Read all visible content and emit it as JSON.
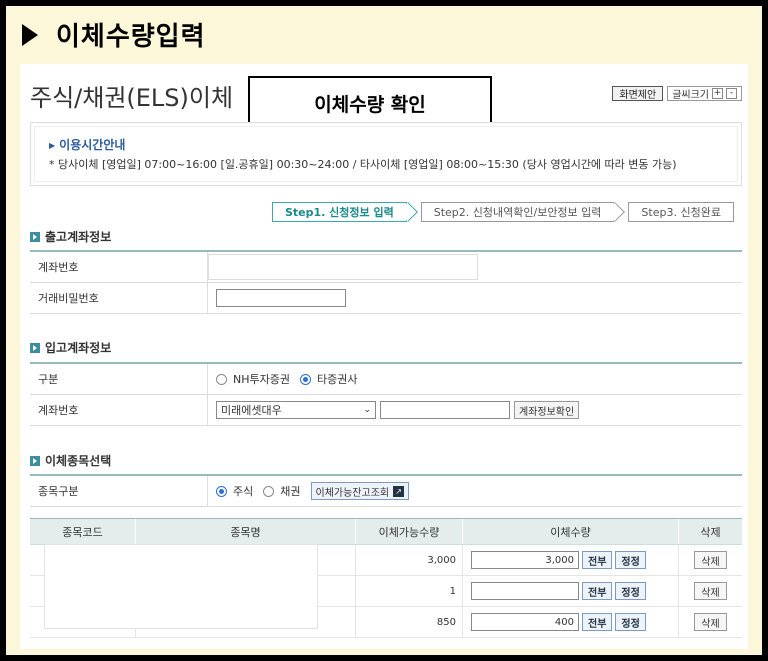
{
  "slide_title": "이체수량입력",
  "page_title": "주식/채권(ELS)이체",
  "callout": "이체수량 확인",
  "top_buttons": {
    "screen_limit": "화면제안",
    "font_size": "글씨크기",
    "plus": "+",
    "minus": "-"
  },
  "info": {
    "title": "이용시간안내",
    "text": "* 당사이체 [영업일] 07:00~16:00 [일.공휴일] 00:30~24:00 / 타사이체 [영업일] 08:00~15:30 (당사 영업시간에 따라 변동 가능)"
  },
  "steps": [
    "Step1. 신청정보 입력",
    "Step2. 신청내역확인/보안정보 입력",
    "Step3. 신청완료"
  ],
  "withdraw": {
    "title": "출고계좌정보",
    "account_label": "계좌번호",
    "account_value": "",
    "password_label": "거래비밀번호",
    "password_value": ""
  },
  "deposit": {
    "title": "입고계좌정보",
    "type_label": "구분",
    "type_options": [
      "NH투자증권",
      "타증권사"
    ],
    "type_selected": "타증권사",
    "account_label": "계좌번호",
    "broker_selected": "미래에셋대우",
    "account_value": "",
    "confirm_button": "계좌정보확인"
  },
  "item_select": {
    "title": "이체종목선택",
    "type_label": "종목구분",
    "type_options": [
      "주식",
      "채권"
    ],
    "type_selected": "주식",
    "inquiry_button": "이체가능잔고조회"
  },
  "grid": {
    "headers": [
      "종목코드",
      "종목명",
      "이체가능수량",
      "이체수량",
      "삭제"
    ],
    "rows": [
      {
        "code": "",
        "name": "",
        "available": "3,000",
        "qty": "3,000"
      },
      {
        "code": "",
        "name": "",
        "available": "1",
        "qty": ""
      },
      {
        "code": "",
        "name": "",
        "available": "850",
        "qty": "400"
      }
    ],
    "all_button": "전부",
    "edit_button": "정정",
    "delete_button": "삭제"
  }
}
